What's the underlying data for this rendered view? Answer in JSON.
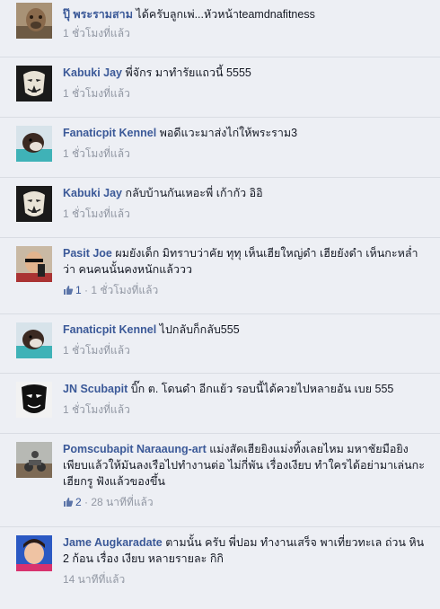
{
  "comments": [
    {
      "author": "ปุ๊ พระรามสาม",
      "text": "ได้ครับลูกเพ่...หัวหน้าteamdnafitness",
      "time": "1 ชั่วโมงที่แล้ว"
    },
    {
      "author": "Kabuki Jay",
      "text": "พี่จักร มาทำรัยแถวนี้ 5555",
      "time": "1 ชั่วโมงที่แล้ว"
    },
    {
      "author": "Fanaticpit Kennel",
      "text": "พอดีแวะมาส่งไก่ให้พระราม3",
      "time": "1 ชั่วโมงที่แล้ว"
    },
    {
      "author": "Kabuki Jay",
      "text": "กลับบ้านกันเหอะพี่ เก้ากัว อิอิ",
      "time": "1 ชั่วโมงที่แล้ว"
    },
    {
      "author": "Pasit Joe",
      "text": "ผมยังเด็ก มิทราบว่าคัย ทุทุ เห็นเฮียใหญ่ดำ เฮียยังดำ เห็นกะหล่ำว่า คนคนนั้นคงหนักแล้ววว",
      "likes": "1",
      "time": "1 ชั่วโมงที่แล้ว"
    },
    {
      "author": "Fanaticpit Kennel",
      "text": "ไปกลับก็กลับ555",
      "time": "1 ชั่วโมงที่แล้ว"
    },
    {
      "author": "JN Scubapit",
      "text": "บิ๊ก ต. โดนดำ อีกแย้ว รอบนี้ได้ควยไปหลายอัน เบย 555",
      "time": "1 ชั่วโมงที่แล้ว"
    },
    {
      "author": "Pomscubapit Naraaung-art",
      "text": "แม่งสัดเฮียยิงแม่งทิ้งเลยไหม มหาชัยมือยิงเพียบแล้วให้มันลงเรือไปทำงานต่อ ไม่กี่พัน เรื่องเงียบ ทำใครได้อย่ามาเล่นกะเฮียกรู ฟังแล้วของขึ้น",
      "likes": "2",
      "time": "28 นาทีที่แล้ว"
    },
    {
      "author": "Jame Augkaradate",
      "text": "ตามนั้น ครับ พี่ปอม ทำงานเสร็จ พาเที่ยวทะเล ถ่วน หิน 2 ก้อน เรื่อง เงียบ หลายรายละ กิกิ",
      "time": "14 นาทีที่แล้ว"
    }
  ]
}
